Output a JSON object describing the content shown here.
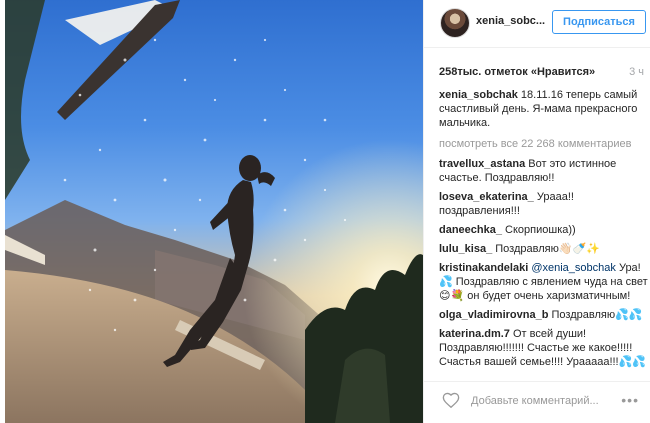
{
  "post": {
    "photo_icon": "photo-shower-beach"
  },
  "header": {
    "username": "xenia_sobc...",
    "follow_label": "Подписаться"
  },
  "stats": {
    "likes": "258тыс. отметок «Нравится»",
    "time_ago": "3 ч"
  },
  "caption": {
    "user": "xenia_sobchak",
    "text": " 18.11.16 теперь самый счастливый день. Я-мама прекрасного мальчика."
  },
  "view_all": "посмотреть все 22 268 комментариев",
  "comments": [
    {
      "user": "travellux_astana",
      "text": " Вот это истинное счастье. Поздравляю!!"
    },
    {
      "user": "loseva_ekaterina_",
      "text": " Урааа!! поздравления!!!"
    },
    {
      "user": "daneechka_",
      "text": " Скорпиошка))"
    },
    {
      "user": "lulu_kisa_",
      "text": " Поздравляю👋🏻🍼✨"
    },
    {
      "user": "kristinakandelaki",
      "mention": " @xenia_sobchak",
      "text": " Ура! 💦 Поздравляю с явлением чуда на свет😊💐 он будет очень харизматичным!"
    },
    {
      "user": "olga_vladimirovna_b",
      "text": " Поздравляю💦💦"
    },
    {
      "user": "katerina.dm.7",
      "text": " От всей души! Поздравляю!!!!!!! Счастье же какое!!!!! Счастья вашей семье!!!! Урааааа!!!💦💦"
    }
  ],
  "footer": {
    "placeholder": "Добавьте комментарий...",
    "more_label": "•••"
  },
  "colors": {
    "accent": "#3897f0",
    "text": "#262626",
    "muted": "#999999"
  }
}
